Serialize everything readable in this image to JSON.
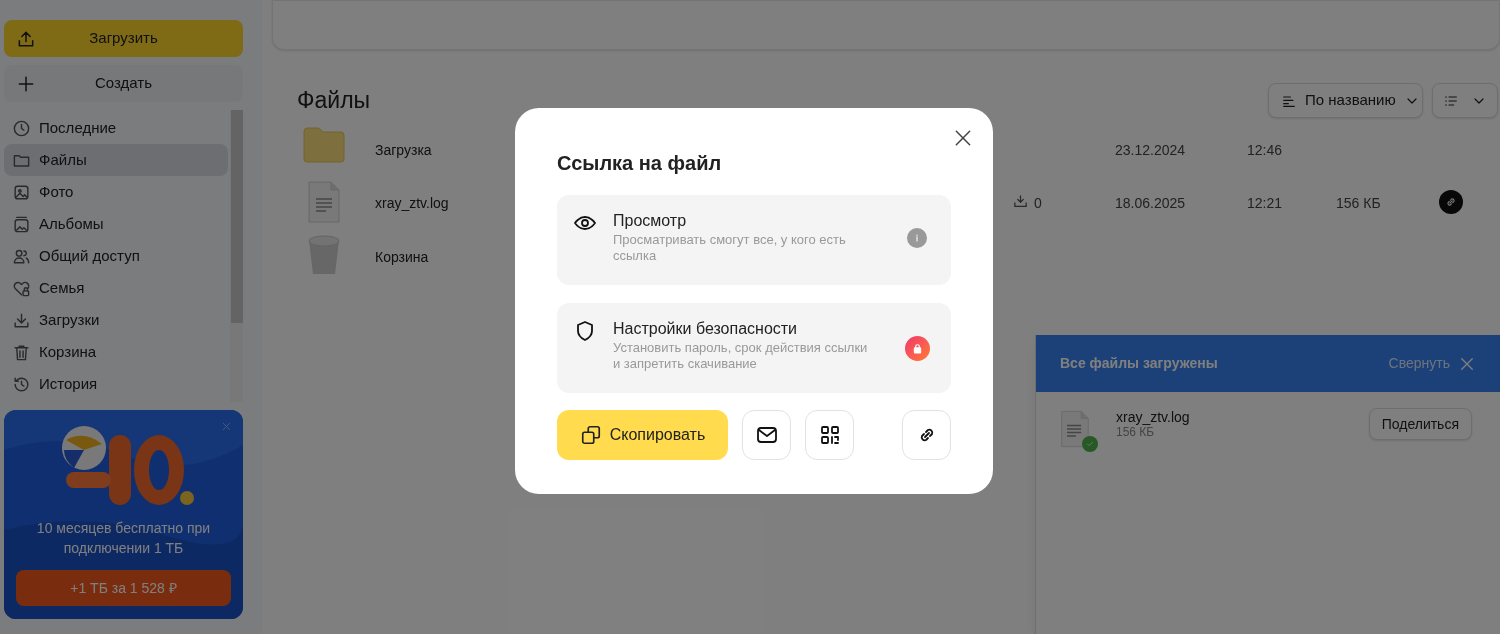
{
  "sidebar": {
    "upload_button": "Загрузить",
    "create_button": "Создать",
    "items": [
      {
        "kind": "recent",
        "label": "Последние",
        "selected": false
      },
      {
        "kind": "folder",
        "label": "Файлы",
        "selected": true
      },
      {
        "label": "Фото",
        "selected": false
      },
      {
        "kind": "album",
        "label": "Альбомы",
        "selected": false
      },
      {
        "kind": "shared",
        "label": "Общий доступ",
        "selected": false
      },
      {
        "kind": "family",
        "label": "Семья",
        "selected": false
      },
      {
        "kind": "downloads",
        "label": "Загрузки",
        "selected": false
      },
      {
        "kind": "trash",
        "label": "Корзина",
        "selected": false
      },
      {
        "kind": "history",
        "label": "История",
        "selected": false
      }
    ],
    "promo": {
      "kind": "picture",
      "text": "10 месяцев бесплатно при подключении 1 ТБ",
      "button": "+1 ТБ за 1 528 ₽"
    }
  },
  "main": {
    "title": "Файлы",
    "sort": "По названию",
    "files": [
      {
        "kind": "folder",
        "name": "Загрузка",
        "date": "23.12.2024",
        "time": "12:46",
        "shared": false
      },
      {
        "kind": "file",
        "name": "xray_ztv.log",
        "downloads": "0",
        "date": "18.06.2025",
        "time": "12:21",
        "size": "156 КБ",
        "shared": true
      },
      {
        "kind": "trash",
        "name": "Корзина",
        "shared": false
      }
    ]
  },
  "dialog": {
    "title": "Ссылка на файл",
    "options": [
      {
        "kind": "view",
        "title": "Просмотр",
        "description": "Просматривать смогут все, у кого есть ссылка"
      },
      {
        "kind": "security",
        "title": "Настройки безопасности",
        "description": "Установить пароль, срок действия ссылки и запретить скачивание"
      }
    ],
    "copy_button": "Скопировать",
    "actions": [
      {
        "kind": "mail"
      },
      {
        "kind": "qr"
      },
      {
        "kind": "link"
      }
    ]
  },
  "upload_panel": {
    "title": "Все файлы загружены",
    "collapse": "Свернуть",
    "items": [
      {
        "name": "xray_ztv.log",
        "size": "156 КБ",
        "done": true,
        "share_button": "Поделиться"
      }
    ]
  }
}
